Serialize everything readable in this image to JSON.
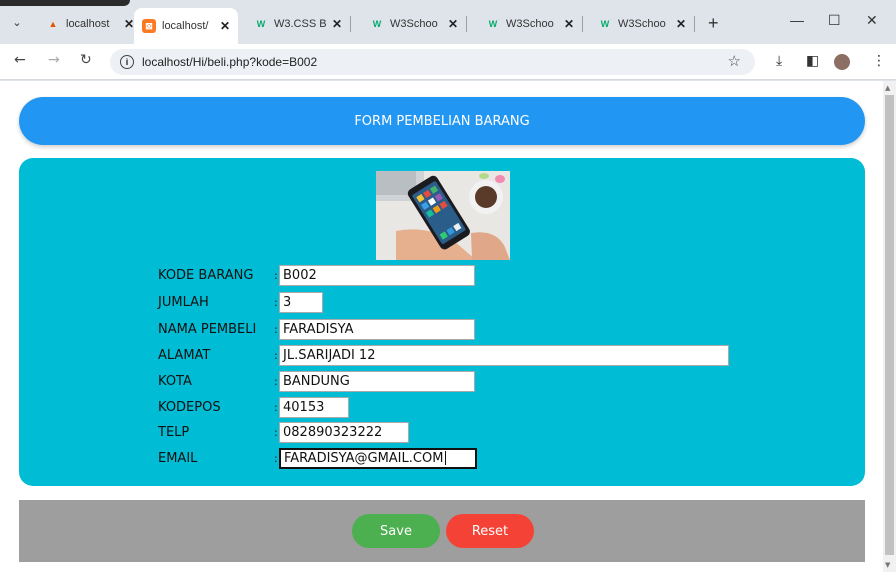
{
  "browser": {
    "tabs": [
      {
        "label": "localhost",
        "icon": "xampp-favicon-icon"
      },
      {
        "label": "localhost/",
        "icon": "xampp-favicon-icon"
      },
      {
        "label": "W3.CSS B",
        "icon": "w3schools-favicon-icon"
      },
      {
        "label": "W3Schoo",
        "icon": "w3schools-favicon-icon"
      },
      {
        "label": "W3Schoo",
        "icon": "w3schools-favicon-icon"
      },
      {
        "label": "W3Schoo",
        "icon": "w3schools-favicon-icon"
      }
    ],
    "active_tab_index": 1,
    "url": "localhost/Hi/beli.php?kode=B002"
  },
  "page": {
    "title": "FORM PEMBELIAN BARANG",
    "fields": [
      {
        "label": "KODE BARANG",
        "value": "B002"
      },
      {
        "label": "JUMLAH",
        "value": "3"
      },
      {
        "label": "NAMA PEMBELI",
        "value": "FARADISYA"
      },
      {
        "label": "ALAMAT",
        "value": "JL.SARIJADI 12"
      },
      {
        "label": "KOTA",
        "value": "BANDUNG"
      },
      {
        "label": "KODEPOS",
        "value": "40153"
      },
      {
        "label": "TELP",
        "value": "082890323222"
      },
      {
        "label": "EMAIL",
        "value": "FARADISYA@GMAIL.COM"
      }
    ],
    "buttons": {
      "save": "Save",
      "reset": "Reset"
    },
    "colors": {
      "header": "#2196f3",
      "card": "#00bcd4",
      "footer": "#9e9e9e",
      "save": "#4caf50",
      "reset": "#f44336"
    }
  }
}
